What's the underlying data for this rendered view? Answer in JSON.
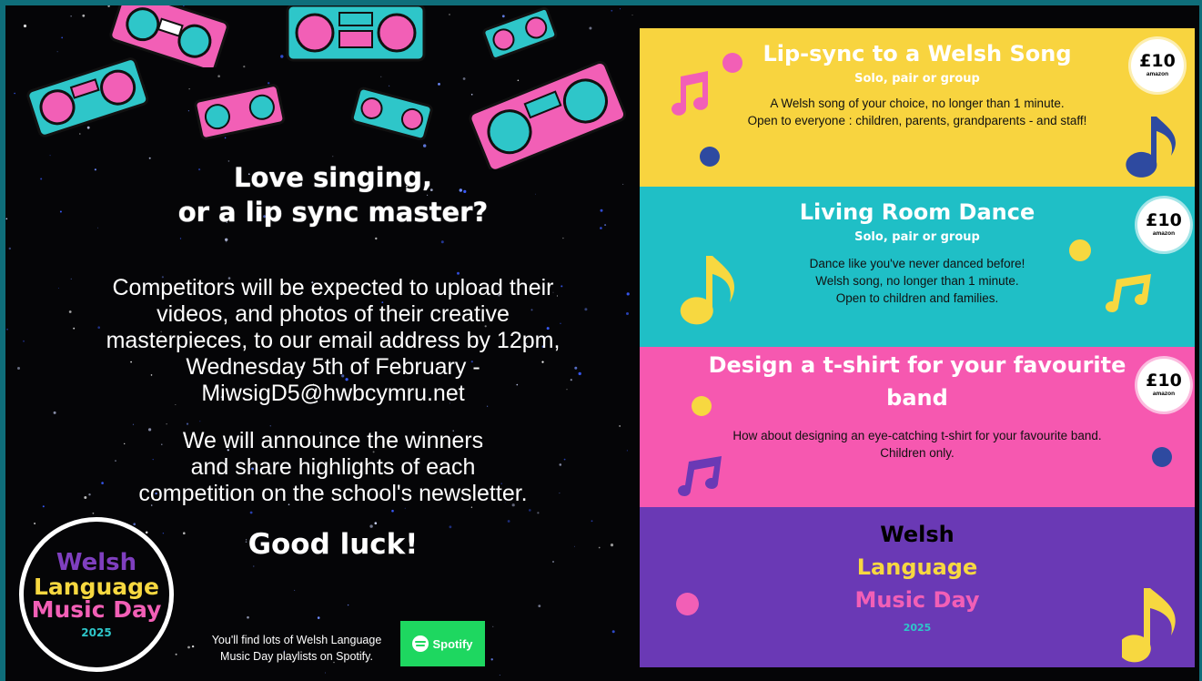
{
  "left": {
    "heading_line1": "Love singing,",
    "heading_line2": "or a lip sync master?",
    "paragraph1": [
      "Competitors will be expected to upload their",
      "videos, and photos of their creative",
      "masterpieces, to our email address by 12pm,",
      "Wednesday 5th of February -",
      "MiwsigD5@hwbcymru.net"
    ],
    "paragraph2": [
      "We will announce the winners",
      "and share highlights of each",
      "competition on the school's newsletter."
    ],
    "good_luck": "Good luck!",
    "spotify_note_line1": "You'll find lots of Welsh Language",
    "spotify_note_line2": "Music Day playlists on Spotify.",
    "spotify_label": "Spotify"
  },
  "logo": {
    "line1": "Welsh",
    "line2": "Language",
    "line3": "Music Day",
    "year": "2025"
  },
  "competitions": [
    {
      "title": "Lip-sync to a Welsh Song",
      "subtitle": "Solo, pair or group",
      "desc_line1": "A Welsh song of your choice, no longer than 1 minute.",
      "desc_line2": "Open to everyone : children, parents, grandparents - and staff!",
      "prize": "£10",
      "prize_brand": "amazon",
      "color": "#f8d43f"
    },
    {
      "title": "Living Room Dance",
      "subtitle": "Solo, pair or group",
      "desc_line1": "Dance like you've never danced before!",
      "desc_line2": "Welsh song, no longer than 1 minute.",
      "desc_line3": "Open to children and families.",
      "prize": "£10",
      "prize_brand": "amazon",
      "color": "#1fbfc6"
    },
    {
      "title_line1": "Design a t-shirt for your favourite",
      "title_line2": "band",
      "desc_line1": "How about designing an eye-catching t-shirt for your favourite band.",
      "desc_line2": "Children only.",
      "prize": "£10",
      "prize_brand": "amazon",
      "color": "#f658b0"
    }
  ],
  "footer_panel": {
    "line1": "Welsh",
    "line2": "Language",
    "line3": "Music Day",
    "year": "2025",
    "color": "#6a39b5"
  },
  "colors": {
    "teal": "#2ec6c9",
    "pink": "#f25fb6",
    "yellow": "#f7d840",
    "purple": "#6a39b5",
    "navy": "#2e4aa0"
  },
  "icons": [
    "boombox-icon",
    "music-note-icon",
    "spotify-icon"
  ]
}
